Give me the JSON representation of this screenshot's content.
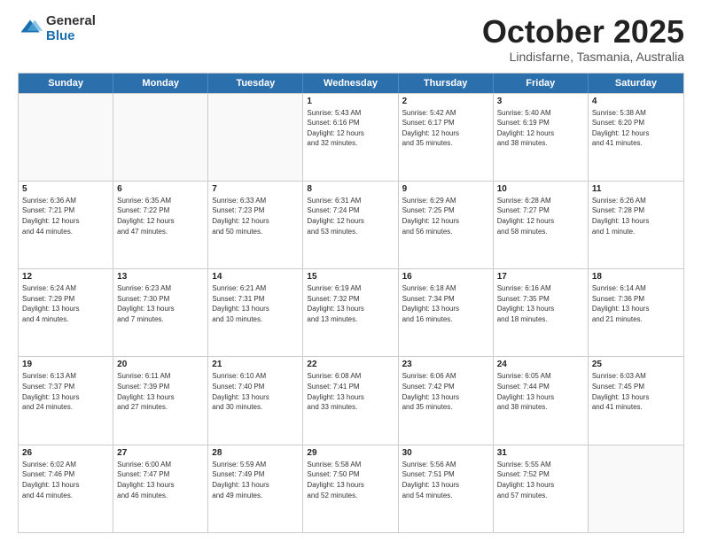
{
  "header": {
    "logo_general": "General",
    "logo_blue": "Blue",
    "month_title": "October 2025",
    "location": "Lindisfarne, Tasmania, Australia"
  },
  "weekdays": [
    "Sunday",
    "Monday",
    "Tuesday",
    "Wednesday",
    "Thursday",
    "Friday",
    "Saturday"
  ],
  "rows": [
    [
      {
        "day": "",
        "info": ""
      },
      {
        "day": "",
        "info": ""
      },
      {
        "day": "",
        "info": ""
      },
      {
        "day": "1",
        "info": "Sunrise: 5:43 AM\nSunset: 6:16 PM\nDaylight: 12 hours\nand 32 minutes."
      },
      {
        "day": "2",
        "info": "Sunrise: 5:42 AM\nSunset: 6:17 PM\nDaylight: 12 hours\nand 35 minutes."
      },
      {
        "day": "3",
        "info": "Sunrise: 5:40 AM\nSunset: 6:19 PM\nDaylight: 12 hours\nand 38 minutes."
      },
      {
        "day": "4",
        "info": "Sunrise: 5:38 AM\nSunset: 6:20 PM\nDaylight: 12 hours\nand 41 minutes."
      }
    ],
    [
      {
        "day": "5",
        "info": "Sunrise: 6:36 AM\nSunset: 7:21 PM\nDaylight: 12 hours\nand 44 minutes."
      },
      {
        "day": "6",
        "info": "Sunrise: 6:35 AM\nSunset: 7:22 PM\nDaylight: 12 hours\nand 47 minutes."
      },
      {
        "day": "7",
        "info": "Sunrise: 6:33 AM\nSunset: 7:23 PM\nDaylight: 12 hours\nand 50 minutes."
      },
      {
        "day": "8",
        "info": "Sunrise: 6:31 AM\nSunset: 7:24 PM\nDaylight: 12 hours\nand 53 minutes."
      },
      {
        "day": "9",
        "info": "Sunrise: 6:29 AM\nSunset: 7:25 PM\nDaylight: 12 hours\nand 56 minutes."
      },
      {
        "day": "10",
        "info": "Sunrise: 6:28 AM\nSunset: 7:27 PM\nDaylight: 12 hours\nand 58 minutes."
      },
      {
        "day": "11",
        "info": "Sunrise: 6:26 AM\nSunset: 7:28 PM\nDaylight: 13 hours\nand 1 minute."
      }
    ],
    [
      {
        "day": "12",
        "info": "Sunrise: 6:24 AM\nSunset: 7:29 PM\nDaylight: 13 hours\nand 4 minutes."
      },
      {
        "day": "13",
        "info": "Sunrise: 6:23 AM\nSunset: 7:30 PM\nDaylight: 13 hours\nand 7 minutes."
      },
      {
        "day": "14",
        "info": "Sunrise: 6:21 AM\nSunset: 7:31 PM\nDaylight: 13 hours\nand 10 minutes."
      },
      {
        "day": "15",
        "info": "Sunrise: 6:19 AM\nSunset: 7:32 PM\nDaylight: 13 hours\nand 13 minutes."
      },
      {
        "day": "16",
        "info": "Sunrise: 6:18 AM\nSunset: 7:34 PM\nDaylight: 13 hours\nand 16 minutes."
      },
      {
        "day": "17",
        "info": "Sunrise: 6:16 AM\nSunset: 7:35 PM\nDaylight: 13 hours\nand 18 minutes."
      },
      {
        "day": "18",
        "info": "Sunrise: 6:14 AM\nSunset: 7:36 PM\nDaylight: 13 hours\nand 21 minutes."
      }
    ],
    [
      {
        "day": "19",
        "info": "Sunrise: 6:13 AM\nSunset: 7:37 PM\nDaylight: 13 hours\nand 24 minutes."
      },
      {
        "day": "20",
        "info": "Sunrise: 6:11 AM\nSunset: 7:39 PM\nDaylight: 13 hours\nand 27 minutes."
      },
      {
        "day": "21",
        "info": "Sunrise: 6:10 AM\nSunset: 7:40 PM\nDaylight: 13 hours\nand 30 minutes."
      },
      {
        "day": "22",
        "info": "Sunrise: 6:08 AM\nSunset: 7:41 PM\nDaylight: 13 hours\nand 33 minutes."
      },
      {
        "day": "23",
        "info": "Sunrise: 6:06 AM\nSunset: 7:42 PM\nDaylight: 13 hours\nand 35 minutes."
      },
      {
        "day": "24",
        "info": "Sunrise: 6:05 AM\nSunset: 7:44 PM\nDaylight: 13 hours\nand 38 minutes."
      },
      {
        "day": "25",
        "info": "Sunrise: 6:03 AM\nSunset: 7:45 PM\nDaylight: 13 hours\nand 41 minutes."
      }
    ],
    [
      {
        "day": "26",
        "info": "Sunrise: 6:02 AM\nSunset: 7:46 PM\nDaylight: 13 hours\nand 44 minutes."
      },
      {
        "day": "27",
        "info": "Sunrise: 6:00 AM\nSunset: 7:47 PM\nDaylight: 13 hours\nand 46 minutes."
      },
      {
        "day": "28",
        "info": "Sunrise: 5:59 AM\nSunset: 7:49 PM\nDaylight: 13 hours\nand 49 minutes."
      },
      {
        "day": "29",
        "info": "Sunrise: 5:58 AM\nSunset: 7:50 PM\nDaylight: 13 hours\nand 52 minutes."
      },
      {
        "day": "30",
        "info": "Sunrise: 5:56 AM\nSunset: 7:51 PM\nDaylight: 13 hours\nand 54 minutes."
      },
      {
        "day": "31",
        "info": "Sunrise: 5:55 AM\nSunset: 7:52 PM\nDaylight: 13 hours\nand 57 minutes."
      },
      {
        "day": "",
        "info": ""
      }
    ]
  ]
}
